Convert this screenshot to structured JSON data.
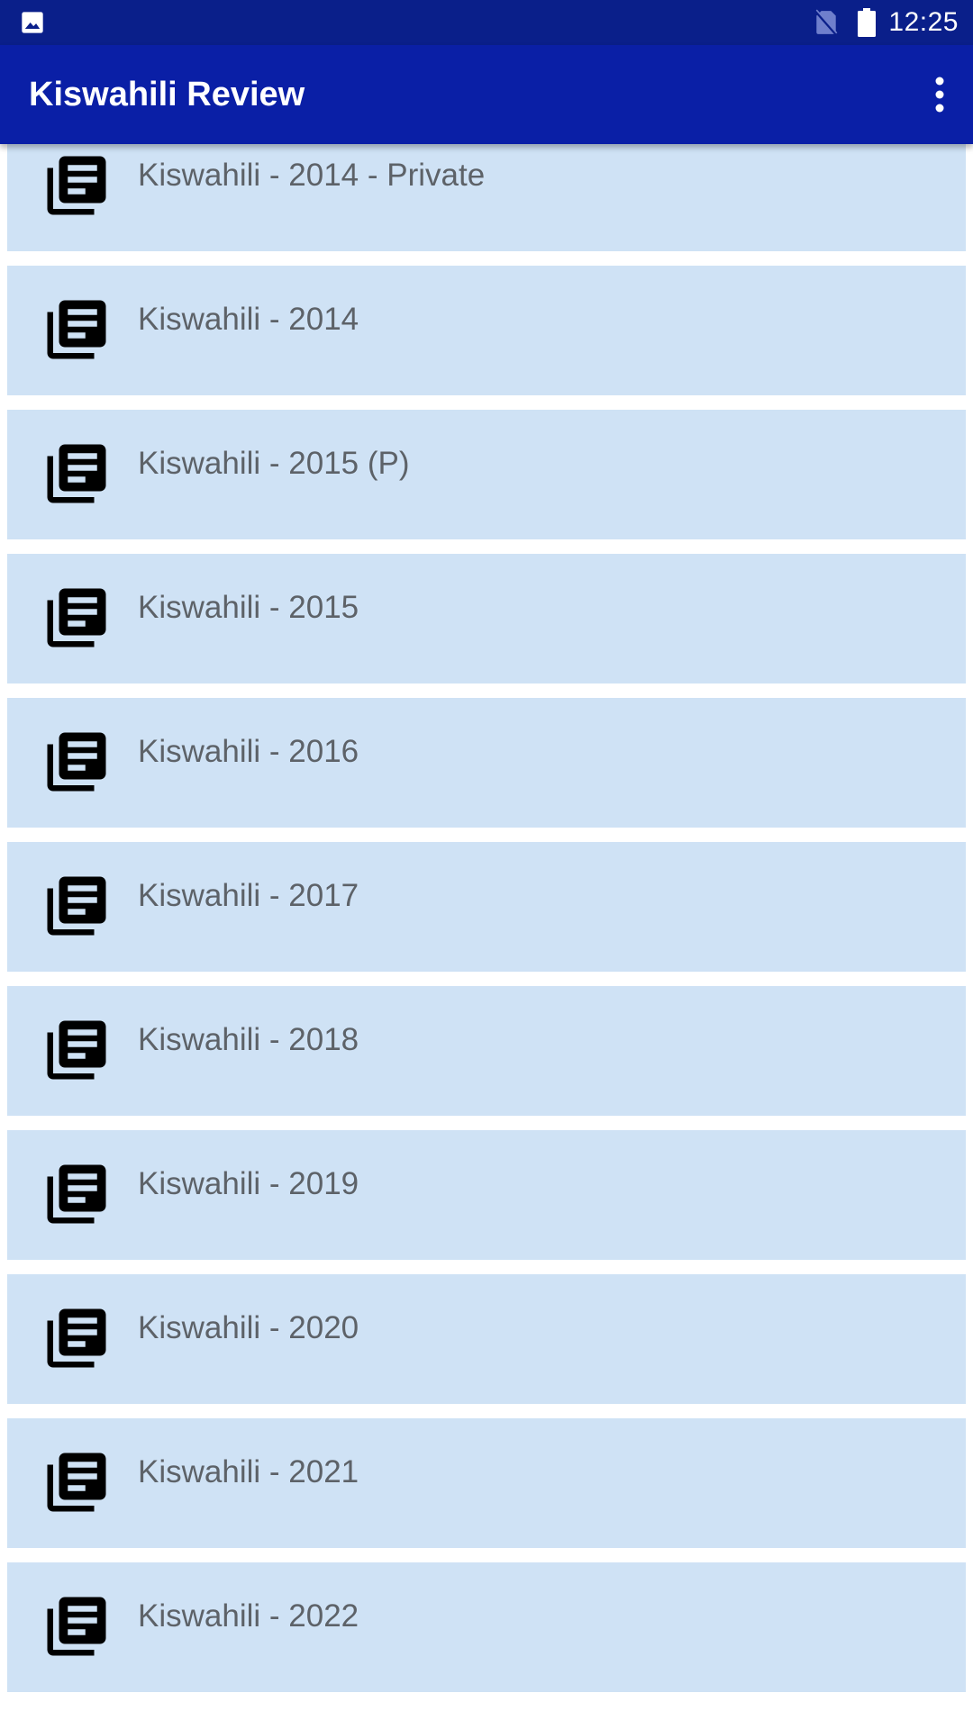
{
  "status_bar": {
    "time": "12:25",
    "icons": [
      "image-notification-icon",
      "no-sim-icon",
      "battery-icon"
    ]
  },
  "app_bar": {
    "title": "Kiswahili Review",
    "menu_icon": "more-vertical-icon"
  },
  "list": {
    "item_icon": "library-books-icon",
    "items": [
      {
        "label": "Kiswahili - 2014 - Private"
      },
      {
        "label": "Kiswahili - 2014"
      },
      {
        "label": "Kiswahili - 2015 (P)"
      },
      {
        "label": "Kiswahili - 2015"
      },
      {
        "label": "Kiswahili - 2016"
      },
      {
        "label": "Kiswahili - 2017"
      },
      {
        "label": "Kiswahili - 2018"
      },
      {
        "label": "Kiswahili - 2019"
      },
      {
        "label": "Kiswahili - 2020"
      },
      {
        "label": "Kiswahili - 2021"
      },
      {
        "label": "Kiswahili - 2022"
      }
    ]
  },
  "colors": {
    "status_bar": "#0a1f8a",
    "app_bar": "#0a1fa6",
    "item_background": "#cfe2f5",
    "item_text": "#5d6268"
  }
}
